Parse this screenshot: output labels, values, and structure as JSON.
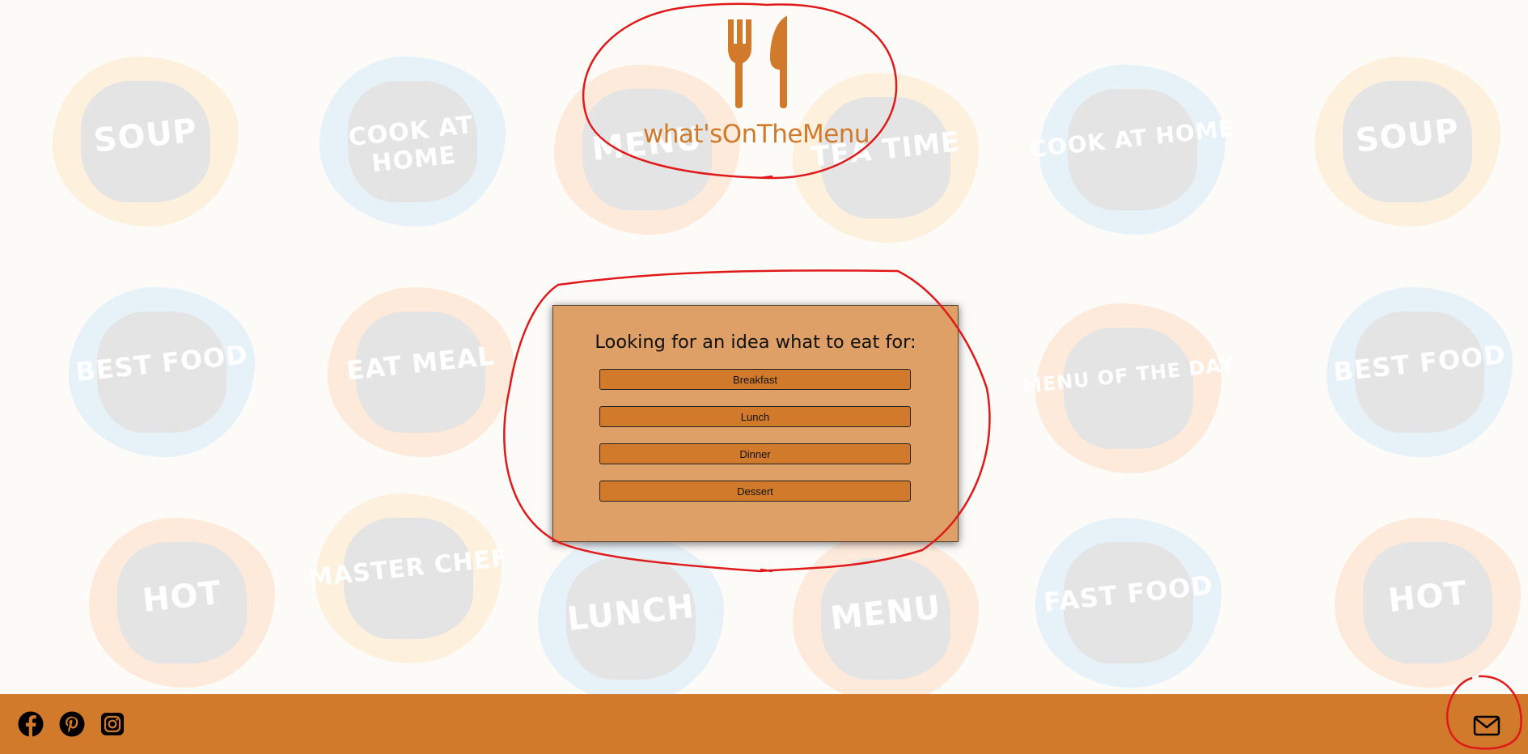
{
  "app": {
    "title": "what'sOnTheMenu",
    "brand_color": "#d17a2b",
    "logo_icon": "fork-and-knife-icon"
  },
  "background_badges": [
    "SOUP",
    "COOK AT HOME",
    "MENU",
    "TEA TIME",
    "COOK AT HOME",
    "SOUP",
    "BEST FOOD",
    "EAT MEAL",
    "MENU OF THE DAY",
    "BEST FOOD",
    "HOT",
    "MASTER CHEF",
    "LUNCH",
    "MENU",
    "FAST FOOD",
    "HOT"
  ],
  "card": {
    "heading": "Looking for an idea what to eat for:",
    "background_color": "#dea067",
    "buttons": [
      {
        "label": "Breakfast"
      },
      {
        "label": "Lunch"
      },
      {
        "label": "Dinner"
      },
      {
        "label": "Dessert"
      }
    ]
  },
  "footer": {
    "background_color": "#d17a2b",
    "social_icons": [
      "facebook-icon",
      "pinterest-icon",
      "instagram-icon"
    ],
    "contact_icon": "mail-icon"
  },
  "annotation_color": "#e0191b"
}
